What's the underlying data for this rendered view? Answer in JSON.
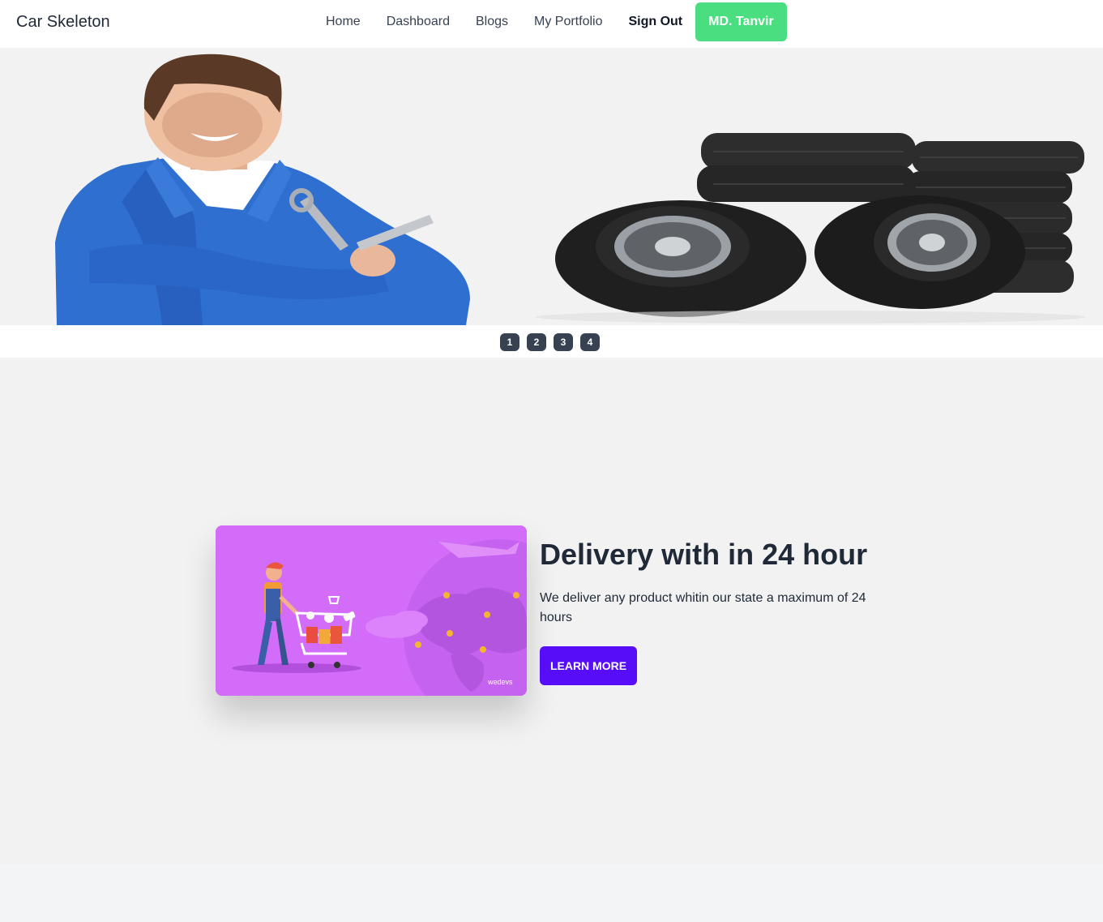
{
  "navbar": {
    "brand": "Car Skeleton",
    "links": [
      {
        "label": "Home"
      },
      {
        "label": "Dashboard"
      },
      {
        "label": "Blogs"
      },
      {
        "label": "My Portfolio"
      }
    ],
    "sign_out": "Sign Out",
    "user_name": "MD. Tanvir",
    "user_button_color": "#4ade80"
  },
  "hero": {
    "image": "mechanic-with-wrench-and-stacked-tires",
    "pager": [
      "1",
      "2",
      "3",
      "4"
    ]
  },
  "feature": {
    "image": "delivery-man-with-shopping-cart-world-map",
    "image_watermark": "wedevs",
    "title": "Delivery with in 24 hour",
    "description": "We deliver any product whitin our state a maximum of 24 hours",
    "button_label": "LEARN MORE",
    "button_color": "#570df8",
    "card_color": "#d36cf9"
  }
}
